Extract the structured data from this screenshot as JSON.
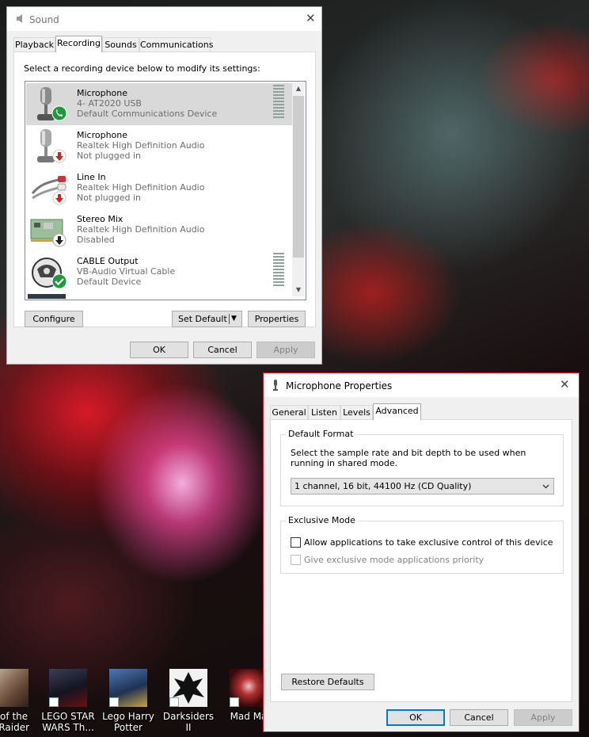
{
  "sound": {
    "title": "Sound",
    "tabs": [
      "Playback",
      "Recording",
      "Sounds",
      "Communications"
    ],
    "instruction": "Select a recording device below to modify its settings:",
    "devices": [
      {
        "name": "Microphone",
        "desc": "4- AT2020 USB",
        "status": "Default Communications Device",
        "badge": "phone-icon"
      },
      {
        "name": "Microphone",
        "desc": "Realtek High Definition Audio",
        "status": "Not plugged in",
        "badge": "red-down-arrow-icon"
      },
      {
        "name": "Line In",
        "desc": "Realtek High Definition Audio",
        "status": "Not plugged in",
        "badge": "red-down-arrow-icon"
      },
      {
        "name": "Stereo Mix",
        "desc": "Realtek High Definition Audio",
        "status": "Disabled",
        "badge": "black-down-arrow-icon"
      },
      {
        "name": "CABLE Output",
        "desc": "VB-Audio Virtual Cable",
        "status": "Default Device",
        "badge": "green-check-icon"
      }
    ],
    "buttons": {
      "configure": "Configure",
      "set_default": "Set Default",
      "properties": "Properties",
      "ok": "OK",
      "cancel": "Cancel",
      "apply": "Apply"
    }
  },
  "mic_props": {
    "title": "Microphone Properties",
    "tabs": [
      "General",
      "Listen",
      "Levels",
      "Advanced"
    ],
    "default_format": {
      "legend": "Default Format",
      "description": "Select the sample rate and bit depth to be used when running in shared mode.",
      "selected": "1 channel, 16 bit, 44100 Hz (CD Quality)"
    },
    "exclusive_mode": {
      "legend": "Exclusive Mode",
      "allow_label": "Allow applications to take exclusive control of this device",
      "allow_checked": false,
      "priority_label": "Give exclusive mode applications priority",
      "priority_checked": false
    },
    "buttons": {
      "restore": "Restore Defaults",
      "ok": "OK",
      "cancel": "Cancel",
      "apply": "Apply"
    }
  },
  "desktop_icons": [
    {
      "label": "e of the\nb Raider"
    },
    {
      "label": "LEGO STAR\nWARS Th..."
    },
    {
      "label": "Lego Harry\nPotter"
    },
    {
      "label": "Darksiders II"
    },
    {
      "label": "Mad Ma"
    }
  ],
  "colors": {
    "accent": "#0078d7",
    "selected_row": "#d9d9d9",
    "dialog_border": "#e81123"
  }
}
